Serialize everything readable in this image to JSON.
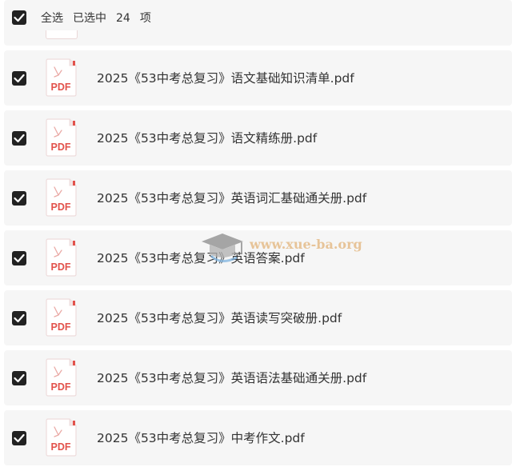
{
  "header": {
    "select_all_label": "全选",
    "selected_label": "已选中",
    "selected_count": "24",
    "unit_label": "项"
  },
  "file_type_label": "PDF",
  "files": [
    {
      "name": "2025《53中考总复习》语文基础知识清单.pdf",
      "checked": true
    },
    {
      "name": "2025《53中考总复习》语文精练册.pdf",
      "checked": true
    },
    {
      "name": "2025《53中考总复习》英语词汇基础通关册.pdf",
      "checked": true
    },
    {
      "name": "2025《53中考总复习》英语答案.pdf",
      "checked": true
    },
    {
      "name": "2025《53中考总复习》英语读写突破册.pdf",
      "checked": true
    },
    {
      "name": "2025《53中考总复习》英语语法基础通关册.pdf",
      "checked": true
    },
    {
      "name": "2025《53中考总复习》中考作文.pdf",
      "checked": true
    }
  ],
  "watermark": {
    "text": "www.xue-ba.org"
  },
  "colors": {
    "pdf_red": "#e2524b",
    "checkbox": "#222222",
    "row_bg": "#f6f6f6"
  }
}
